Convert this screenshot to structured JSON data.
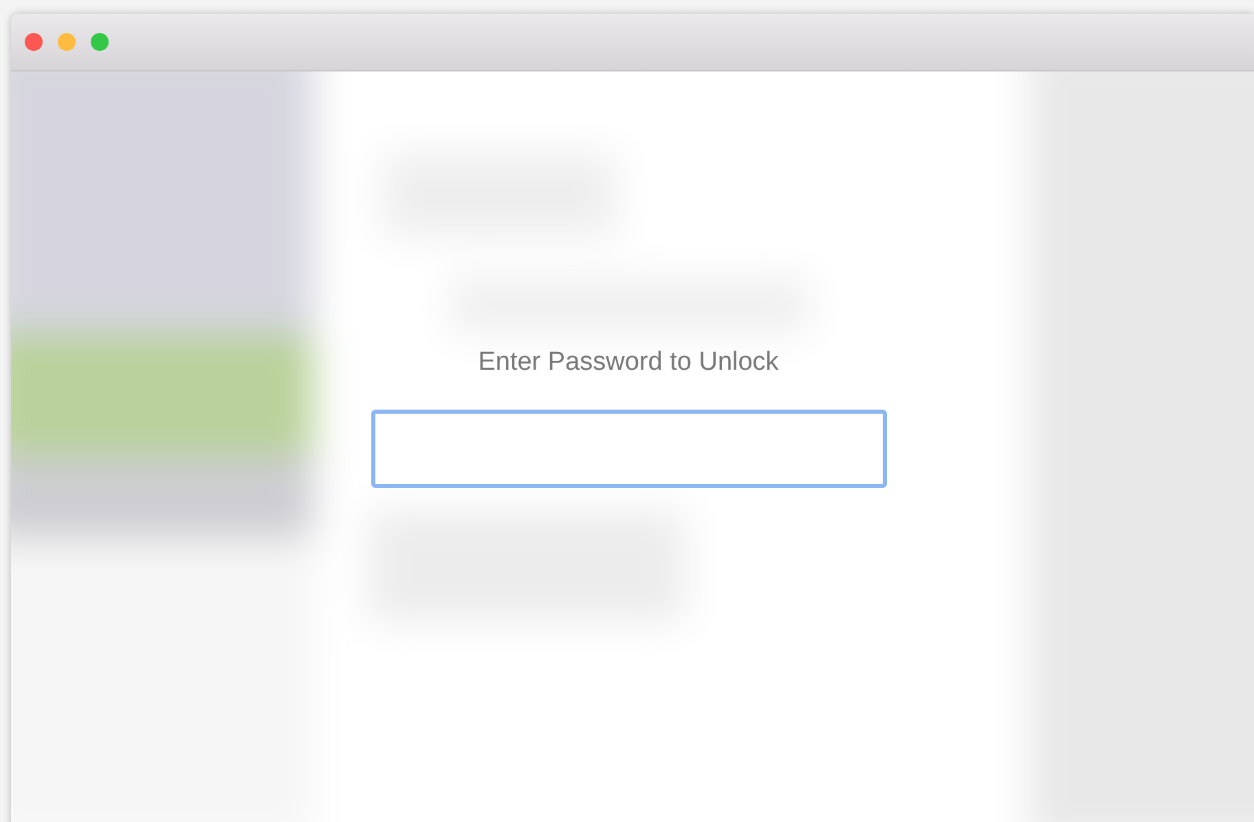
{
  "window": {
    "controls": [
      {
        "kind": "close"
      },
      {
        "kind": "minimize"
      },
      {
        "kind": "zoom"
      }
    ]
  },
  "prompt": "Enter Password to Unlock",
  "password_field": {
    "focused": true
  }
}
